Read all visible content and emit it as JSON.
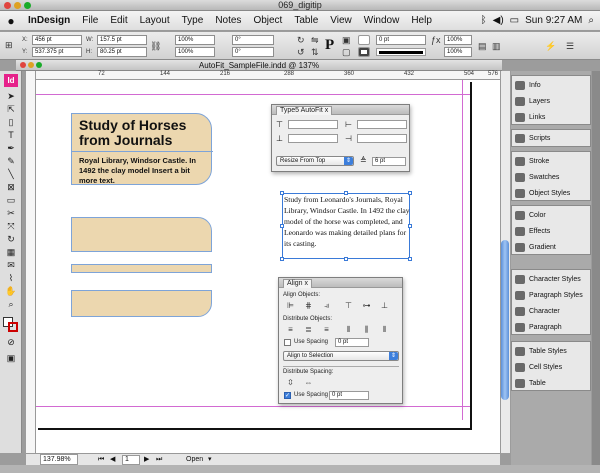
{
  "window": {
    "title": "069_digitip"
  },
  "menubar": {
    "apple": "",
    "app_name": "InDesign",
    "items": [
      "File",
      "Edit",
      "Layout",
      "Type",
      "Notes",
      "Object",
      "Table",
      "View",
      "Window",
      "Help"
    ],
    "clock": "Sun 9:27 AM"
  },
  "control": {
    "x_label": "X:",
    "x_value": "456 pt",
    "y_label": "Y:",
    "y_value": "537.375 pt",
    "w_label": "W:",
    "w_value": "157.5 pt",
    "h_label": "H:",
    "h_value": "80.25 pt",
    "scale_x": "100%",
    "scale_y": "100%",
    "rotate": "0°",
    "shear": "0°",
    "stroke_weight": "0 pt",
    "pct_a": "100%",
    "pct_b": "100%",
    "p_glyph": "P"
  },
  "document": {
    "tab_title": "AutoFit_SampleFile.indd @ 137%",
    "ruler_ticks": [
      "72",
      "144",
      "216",
      "288",
      "360",
      "432",
      "504",
      "576"
    ]
  },
  "canvas": {
    "heading": "Study of Horses from Journals",
    "caption": "Royal Library, Windsor Castle. In 1492 the clay model Insert a bit more text.",
    "body_text": "Study from Leonardo's Journals, Royal Library, Windsor Castle. In 1492 the clay model of the horse was completed, and Leonardo was making detailed plans for its casting."
  },
  "autofit_panel": {
    "tab": "Type5 AutoFit",
    "close": "x",
    "mode": "Resize From Top",
    "spacing": "6 pt"
  },
  "align_panel": {
    "tab": "Align",
    "close": "x",
    "align_objects": "Align Objects:",
    "distribute_objects": "Distribute Objects:",
    "use_spacing_1": "Use Spacing",
    "spacing_1": "0 pt",
    "align_to": "Align to Selection",
    "distribute_spacing": "Distribute Spacing:",
    "use_spacing_2": "Use Spacing",
    "spacing_2": "0 pt"
  },
  "dock": {
    "groups": [
      [
        "Info",
        "Layers",
        "Links"
      ],
      [
        "Scripts"
      ],
      [
        "Stroke",
        "Swatches",
        "Object Styles"
      ],
      [
        "Color",
        "Effects",
        "Gradient"
      ],
      [
        "Character Styles",
        "Paragraph Styles",
        "Character",
        "Paragraph"
      ],
      [
        "Table Styles",
        "Cell Styles",
        "Table"
      ]
    ]
  },
  "status": {
    "zoom": "137.98%",
    "page": "1",
    "open": "Open"
  },
  "colors": {
    "frame_fill": "#ecd7af",
    "frame_stroke": "#7ea4d8",
    "scroll_accent": "#5b8fd8"
  },
  "icons": [
    "apple-icon",
    "selection-tool-icon",
    "pen-tool-icon",
    "type-tool-icon",
    "zoom-tool-icon",
    "hand-tool-icon",
    "align-left-icon",
    "distribute-icon"
  ]
}
